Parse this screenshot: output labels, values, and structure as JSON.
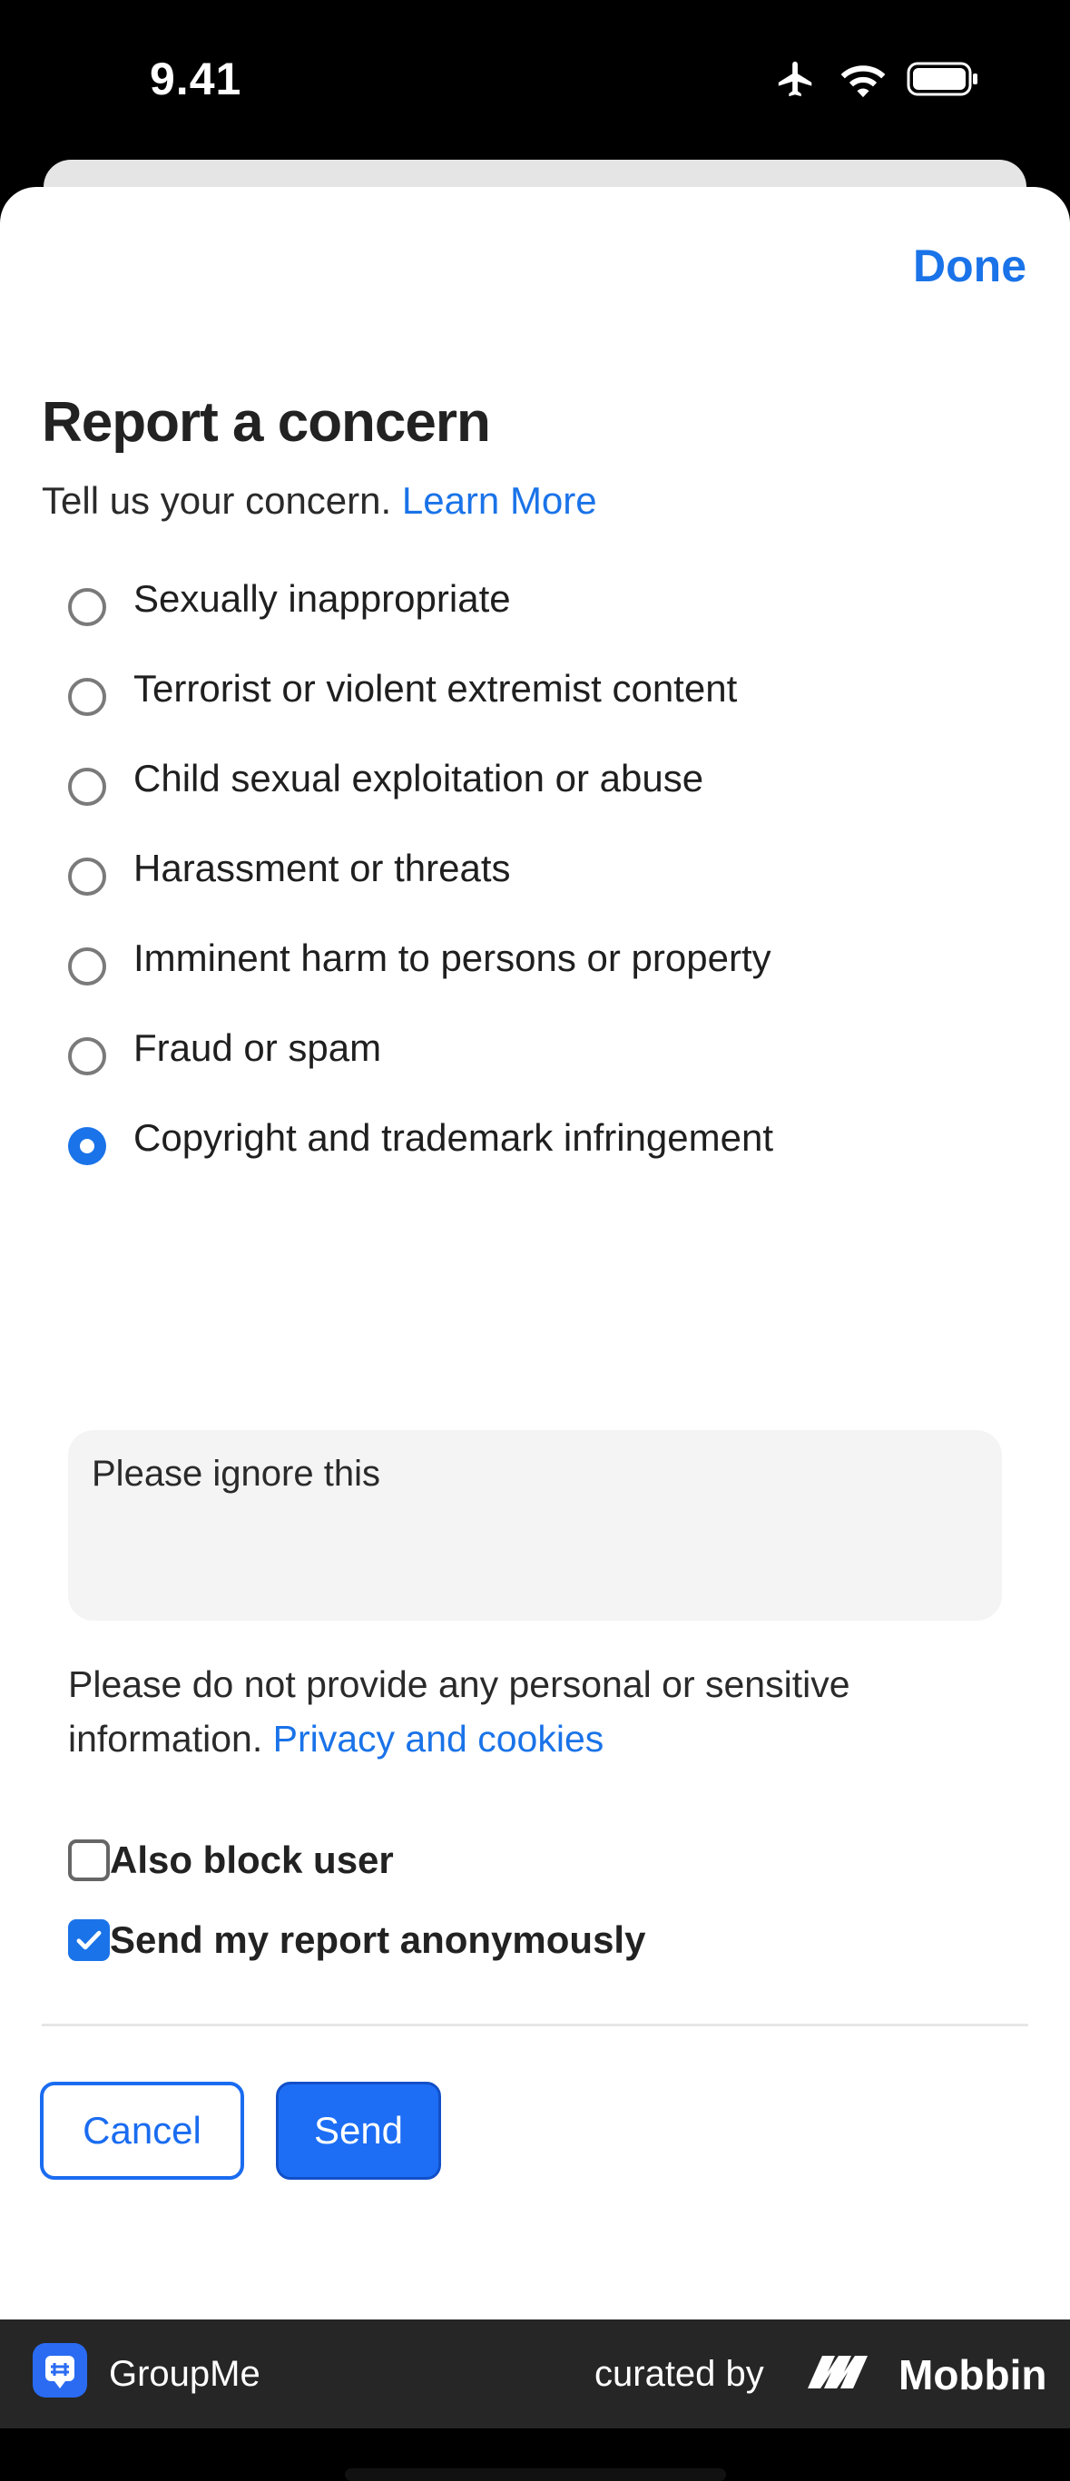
{
  "status_bar": {
    "time": "9.41"
  },
  "header": {
    "done_label": "Done"
  },
  "title": "Report a concern",
  "subtitle": {
    "text": "Tell us your concern.",
    "link": "Learn More"
  },
  "options": [
    {
      "label": "Sexually inappropriate",
      "selected": false
    },
    {
      "label": "Terrorist or violent extremist content",
      "selected": false
    },
    {
      "label": "Child sexual exploitation or abuse",
      "selected": false
    },
    {
      "label": "Harassment or threats",
      "selected": false
    },
    {
      "label": "Imminent harm to persons or property",
      "selected": false
    },
    {
      "label": "Fraud or spam",
      "selected": false
    },
    {
      "label": "Copyright and trademark infringement",
      "selected": true
    }
  ],
  "details": {
    "value": "Please ignore this"
  },
  "notice": {
    "text": "Please do not provide any personal or sensitive information.",
    "link": "Privacy and cookies"
  },
  "checkboxes": [
    {
      "label": "Also block user",
      "checked": false
    },
    {
      "label": "Send my report anonymously",
      "checked": true
    }
  ],
  "actions": {
    "cancel_label": "Cancel",
    "send_label": "Send"
  },
  "footer": {
    "app_name": "GroupMe",
    "curated_by": "curated by",
    "brand": "Mobbin"
  },
  "colors": {
    "accent": "#1a73e8",
    "send_button": "#1d6ef5",
    "footer_bg": "#262626"
  },
  "icons": [
    "airplane-icon",
    "wifi-icon",
    "battery-icon",
    "checkmark-icon",
    "groupme-logo-icon",
    "mobbin-logo-icon"
  ]
}
